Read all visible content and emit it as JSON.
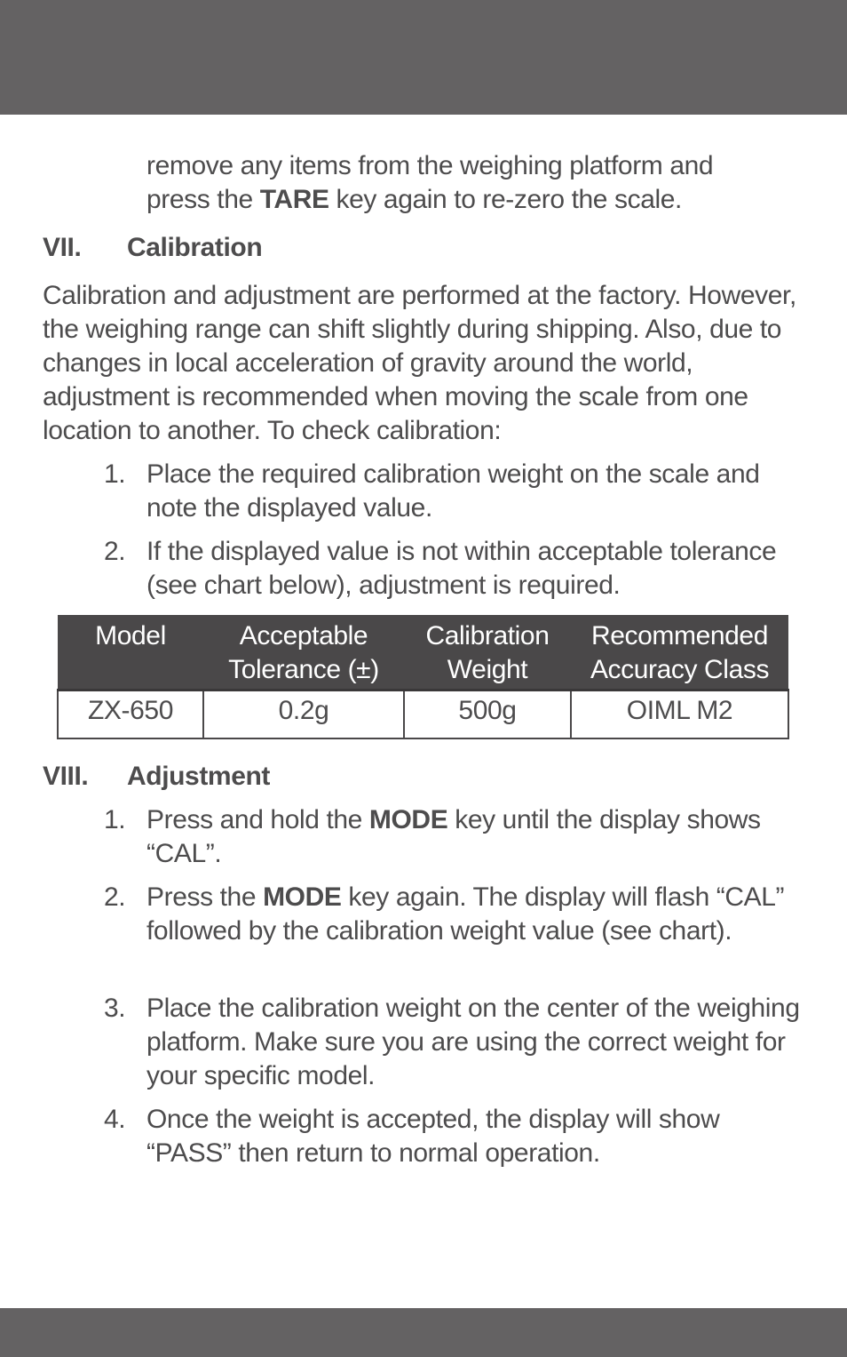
{
  "header_bar": {
    "color": "#646263"
  },
  "footer_bar": {
    "color": "#646263"
  },
  "continuation": {
    "line1": "remove any items from the weighing platform and",
    "line2_pre": "press the ",
    "line2_bold": "TARE",
    "line2_post": " key again to re-zero the scale."
  },
  "section_vii": {
    "number": "VII.",
    "title": "Calibration",
    "intro": "Calibration and adjustment are performed at the factory. However, the weighing range can shift slightly during shipping. Also, due to changes in local acceleration of gravity around the world, adjustment is recommended when moving the scale from one location to another. To check calibration:",
    "steps": [
      {
        "num": "1.",
        "text": "Place the required calibration weight on the scale and note the displayed value."
      },
      {
        "num": "2.",
        "text": "If the displayed value is not within acceptable tolerance (see chart below), adjustment is required."
      }
    ]
  },
  "table": {
    "headers": [
      {
        "line1": "Model",
        "line2": ""
      },
      {
        "line1": "Acceptable",
        "line2": "Tolerance (±)"
      },
      {
        "line1": "Calibration",
        "line2": "Weight"
      },
      {
        "line1": "Recommended",
        "line2": "Accuracy Class"
      }
    ],
    "rows": [
      [
        "ZX-650",
        "0.2g",
        "500g",
        "OIML M2"
      ]
    ]
  },
  "section_viii": {
    "number": "VIII.",
    "title": "Adjustment",
    "steps": [
      {
        "num": "1.",
        "pre": "Press and hold the ",
        "bold": "MODE",
        "post": " key until the display shows “CAL”."
      },
      {
        "num": "2.",
        "pre": "Press the ",
        "bold": "MODE",
        "post": " key again. The display will flash “CAL” followed by the calibration weight value (see chart)."
      },
      {
        "num": "3.",
        "pre": "Place the calibration weight on the center of the weighing platform. Make sure you are using the correct weight for your specific model.",
        "bold": "",
        "post": ""
      },
      {
        "num": "4.",
        "pre": "Once the weight is accepted, the display will show “PASS” then return to normal operation.",
        "bold": "",
        "post": ""
      }
    ]
  }
}
